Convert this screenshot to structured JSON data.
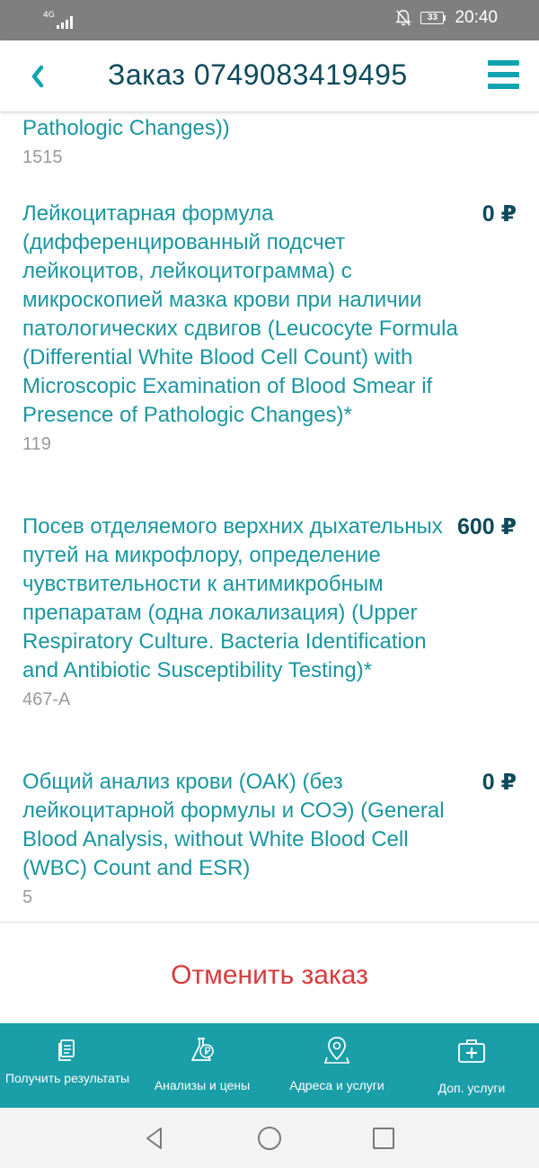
{
  "status_bar": {
    "network": "4G",
    "battery": "33",
    "time": "20:40"
  },
  "header": {
    "title": "Заказ 0749083419495"
  },
  "items": [
    {
      "name": "Pathologic Changes))",
      "code": "1515",
      "price": ""
    },
    {
      "name": "Лейкоцитарная формула (дифференцированный подсчет лейкоцитов, лейкоцитограмма) с микроскопией мазка крови при наличии патологических сдвигов (Leucocyte Formula (Differential White Blood Cell Count) with Microscopic Examination of Blood Smear if Presence of Pathologic Changes)*",
      "code": "119",
      "price": "0 ₽"
    },
    {
      "name": "Посев отделяемого верхних дыхательных путей на микрофлору, определение чувствительности к антимикробным препаратам (одна локализация) (Upper Respiratory Culture. Bacteria Identification and Antibiotic Susceptibility Testing)*",
      "code": "467-А",
      "price": "600 ₽"
    },
    {
      "name": "Общий анализ крови (ОАК) (без лейкоцитарной формулы и СОЭ) (General Blood Analysis, without White Blood Cell (WBC) Count and ESR)",
      "code": "5",
      "price": "0 ₽"
    }
  ],
  "cancel_button": "Отменить заказ",
  "bottom_nav": [
    {
      "label": "Получить результаты",
      "icon": "document-icon"
    },
    {
      "label": "Анализы и цены",
      "icon": "flask-ruble-icon"
    },
    {
      "label": "Адреса и услуги",
      "icon": "map-pin-icon"
    },
    {
      "label": "Доп. услуги",
      "icon": "medical-kit-icon"
    }
  ],
  "colors": {
    "accent": "#1a9ea8",
    "title": "#0e4a5a",
    "link": "#1a96a0",
    "danger": "#d63b3b",
    "status_bar": "#7f7f7f"
  }
}
